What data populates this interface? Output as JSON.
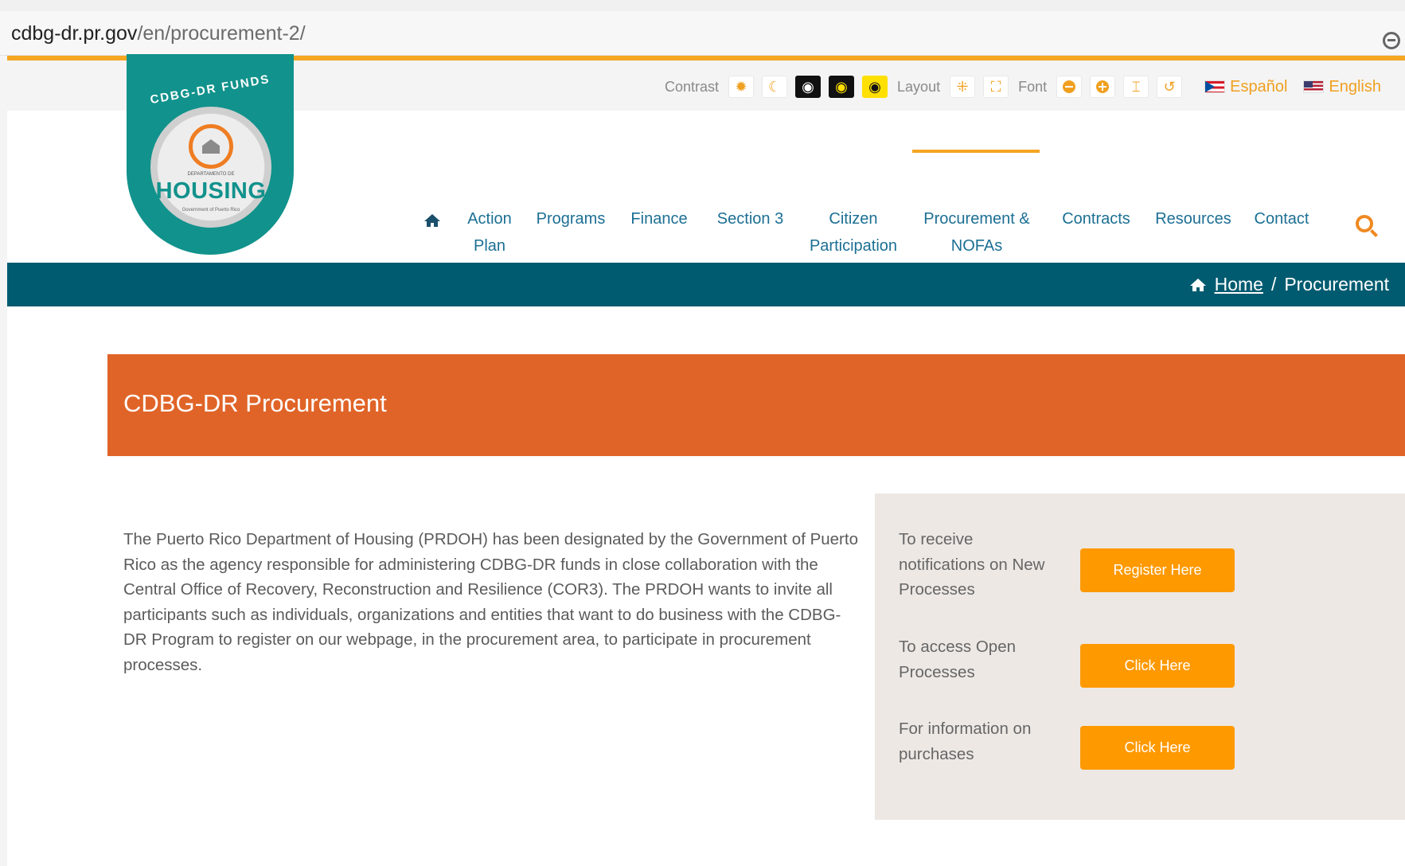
{
  "browser": {
    "url_host": "cdbg-dr.pr.gov",
    "url_path": "/en/procurement-2/"
  },
  "toolbar": {
    "contrast_label": "Contrast",
    "layout_label": "Layout",
    "font_label": "Font",
    "languages": [
      {
        "label": "Español",
        "flag": "puerto-rico-flag"
      },
      {
        "label": "English",
        "flag": "us-flag"
      }
    ]
  },
  "logo": {
    "arc_text": "CDBG-DR FUNDS",
    "dept_small": "DEPARTAMENTO DE",
    "word": "HOUSING",
    "sub": "Government of Puerto Rico"
  },
  "nav": {
    "items": [
      {
        "label": "Action Plan"
      },
      {
        "label": "Programs"
      },
      {
        "label": "Finance"
      },
      {
        "label": "Section 3"
      },
      {
        "label": "Citizen Participation"
      },
      {
        "label": "Procurement & NOFAs"
      },
      {
        "label": "Contracts"
      },
      {
        "label": "Resources"
      },
      {
        "label": "Contact"
      }
    ],
    "active_color": "#f5a623"
  },
  "breadcrumb": {
    "home": "Home",
    "separator": "/",
    "current": "Procurement"
  },
  "hero": {
    "title": "CDBG-DR Procurement",
    "color": "#e06428"
  },
  "intro": {
    "text": "The Puerto Rico Department of Housing (PRDOH) has been designated by the Government of Puerto Rico as the agency responsible for administering CDBG-DR funds in close collaboration with the Central Office of Recovery, Reconstruction and Resilience (COR3). The PRDOH wants to invite all participants such as individuals, organizations and entities that want to do business with the CDBG-DR Program to register on our webpage, in the procurement area, to participate in procurement processes."
  },
  "side_panel": {
    "rows": [
      {
        "text": "To receive notifications on New Processes",
        "button": "Register Here"
      },
      {
        "text": "To access Open Processes",
        "button": "Click Here"
      },
      {
        "text": "For information on purchases",
        "button": "Click Here"
      }
    ],
    "button_color": "#ff9900"
  }
}
